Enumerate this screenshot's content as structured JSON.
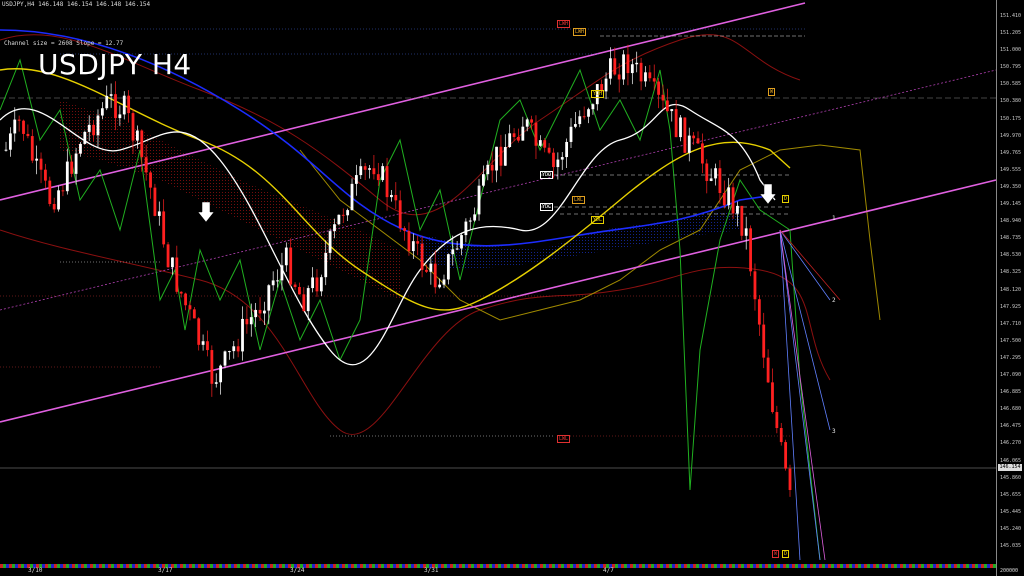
{
  "window": {
    "header": "USDJPY,H4 146.148 146.154 146.148 146.154",
    "channel_info": "Channel size = 2608 Slope = 12.77",
    "symbol_label": "USDJPY H4"
  },
  "price_scale": {
    "labels": [
      "151.410",
      "151.205",
      "151.000",
      "150.795",
      "150.585",
      "150.380",
      "150.175",
      "149.970",
      "149.765",
      "149.555",
      "149.350",
      "149.145",
      "148.940",
      "148.735",
      "148.530",
      "148.325",
      "148.120",
      "147.925",
      "147.710",
      "147.500",
      "147.295",
      "147.090",
      "146.885",
      "146.680",
      "146.475",
      "146.270",
      "146.065",
      "145.860",
      "145.655",
      "145.445",
      "145.240",
      "145.035"
    ],
    "current_price": "146.154"
  },
  "time_axis": {
    "labels": [
      "3/10",
      "3/17",
      "3/24",
      "3/31",
      "4/7"
    ],
    "corner_label": "200000"
  },
  "levels": {
    "labels": [
      "LWH",
      "LWH",
      "YDH",
      "YDO",
      "YDC",
      "LWL",
      "YDL",
      "LWL",
      "W",
      "D",
      "W",
      "D"
    ],
    "line_labels": [
      "1",
      "2",
      "3"
    ]
  },
  "colors": {
    "background": "#000000",
    "channel": "#e060e0",
    "bull_candle": "#ffffff",
    "bear_candle": "#ff2020",
    "ma_fast": "#ffffff",
    "ma_mid": "#e6d000",
    "ma_slow": "#1c2cff",
    "green_line": "#20b020",
    "cloud_red": "#c01010",
    "cloud_blue": "#1028c8"
  }
}
